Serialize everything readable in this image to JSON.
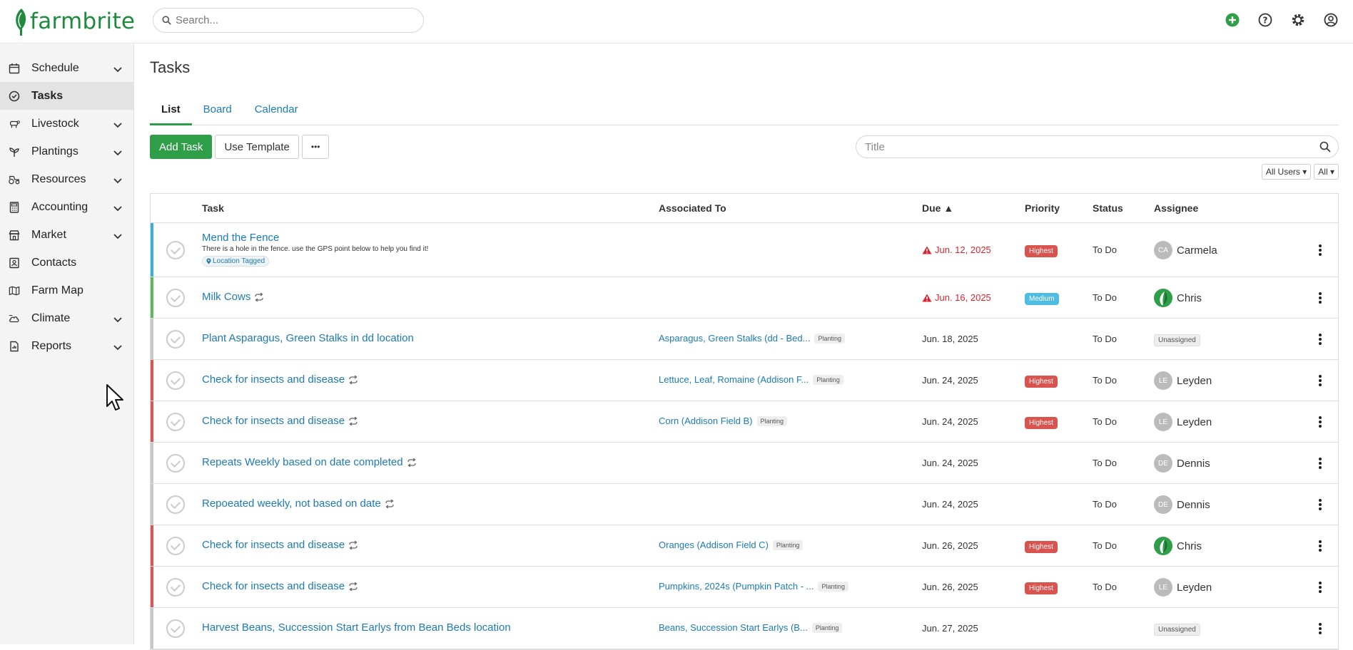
{
  "app": {
    "brand": "farmbrite"
  },
  "search": {
    "placeholder": "Search..."
  },
  "sidebar": {
    "items": [
      {
        "label": "Schedule",
        "icon": "calendar-icon",
        "expandable": true
      },
      {
        "label": "Tasks",
        "icon": "check-circle-icon",
        "expandable": false,
        "active": true
      },
      {
        "label": "Livestock",
        "icon": "livestock-icon",
        "expandable": true
      },
      {
        "label": "Plantings",
        "icon": "seedling-icon",
        "expandable": true
      },
      {
        "label": "Resources",
        "icon": "tractor-icon",
        "expandable": true
      },
      {
        "label": "Accounting",
        "icon": "calculator-icon",
        "expandable": true
      },
      {
        "label": "Market",
        "icon": "store-icon",
        "expandable": true
      },
      {
        "label": "Contacts",
        "icon": "contact-icon",
        "expandable": false
      },
      {
        "label": "Farm Map",
        "icon": "map-icon",
        "expandable": false
      },
      {
        "label": "Climate",
        "icon": "cloud-icon",
        "expandable": true
      },
      {
        "label": "Reports",
        "icon": "report-icon",
        "expandable": true
      }
    ]
  },
  "page": {
    "title": "Tasks"
  },
  "tabs": [
    {
      "label": "List",
      "active": true
    },
    {
      "label": "Board"
    },
    {
      "label": "Calendar"
    }
  ],
  "toolbar": {
    "add_task": "Add Task",
    "use_template": "Use Template",
    "more": "•••",
    "title_placeholder": "Title"
  },
  "filters": {
    "users": "All Users",
    "all": "All"
  },
  "table": {
    "headers": {
      "task": "Task",
      "associated": "Associated To",
      "due": "Due",
      "priority": "Priority",
      "status": "Status",
      "assignee": "Assignee"
    },
    "rows": [
      {
        "title": "Mend the Fence",
        "desc": "There is a hole in the fence. use the GPS point below to help you find it!",
        "tag": "Location Tagged",
        "color": "#3aaee0",
        "assoc": "",
        "assoc_tag": "",
        "due": "Jun. 12, 2025",
        "overdue": true,
        "priority": "Highest",
        "status": "To Do",
        "assignee": "Carmela",
        "initials": "CA",
        "repeat": false
      },
      {
        "title": "Milk Cows",
        "desc": "",
        "tag": "",
        "color": "#5cb85c",
        "assoc": "",
        "assoc_tag": "",
        "due": "Jun. 16, 2025",
        "overdue": true,
        "priority": "Medium",
        "status": "To Do",
        "assignee": "Chris",
        "initials": "",
        "repeat": true
      },
      {
        "title": "Plant Asparagus, Green Stalks in dd location",
        "desc": "",
        "tag": "",
        "color": "#c8c8c8",
        "assoc": "Asparagus, Green Stalks (dd - Bed...",
        "assoc_tag": "Planting",
        "due": "Jun. 18, 2025",
        "overdue": false,
        "priority": "",
        "status": "To Do",
        "assignee": "Unassigned",
        "initials": "",
        "repeat": false
      },
      {
        "title": "Check for insects and disease",
        "desc": "",
        "tag": "",
        "color": "#e05353",
        "assoc": "Lettuce, Leaf, Romaine (Addison F...",
        "assoc_tag": "Planting",
        "due": "Jun. 24, 2025",
        "overdue": false,
        "priority": "Highest",
        "status": "To Do",
        "assignee": "Leyden",
        "initials": "LE",
        "repeat": true
      },
      {
        "title": "Check for insects and disease",
        "desc": "",
        "tag": "",
        "color": "#e05353",
        "assoc": "Corn (Addison Field B)",
        "assoc_tag": "Planting",
        "due": "Jun. 24, 2025",
        "overdue": false,
        "priority": "Highest",
        "status": "To Do",
        "assignee": "Leyden",
        "initials": "LE",
        "repeat": true
      },
      {
        "title": "Repeats Weekly based on date completed",
        "desc": "",
        "tag": "",
        "color": "#c8c8c8",
        "assoc": "",
        "assoc_tag": "",
        "due": "Jun. 24, 2025",
        "overdue": false,
        "priority": "",
        "status": "To Do",
        "assignee": "Dennis",
        "initials": "DE",
        "repeat": true
      },
      {
        "title": "Repoeated weekly, not based on date",
        "desc": "",
        "tag": "",
        "color": "#c8c8c8",
        "assoc": "",
        "assoc_tag": "",
        "due": "Jun. 24, 2025",
        "overdue": false,
        "priority": "",
        "status": "To Do",
        "assignee": "Dennis",
        "initials": "DE",
        "repeat": true
      },
      {
        "title": "Check for insects and disease",
        "desc": "",
        "tag": "",
        "color": "#e05353",
        "assoc": "Oranges (Addison Field C)",
        "assoc_tag": "Planting",
        "due": "Jun. 26, 2025",
        "overdue": false,
        "priority": "Highest",
        "status": "To Do",
        "assignee": "Chris",
        "initials": "",
        "repeat": true
      },
      {
        "title": "Check for insects and disease",
        "desc": "",
        "tag": "",
        "color": "#e05353",
        "assoc": "Pumpkins, 2024s (Pumpkin Patch - ...",
        "assoc_tag": "Planting",
        "due": "Jun. 26, 2025",
        "overdue": false,
        "priority": "Highest",
        "status": "To Do",
        "assignee": "Leyden",
        "initials": "LE",
        "repeat": true
      },
      {
        "title": "Harvest Beans, Succession Start Earlys from Bean Beds location",
        "desc": "",
        "tag": "",
        "color": "#c8c8c8",
        "assoc": "Beans, Succession Start Earlys (B...",
        "assoc_tag": "Planting",
        "due": "Jun. 27, 2025",
        "overdue": false,
        "priority": "",
        "status": "",
        "assignee": "Unassigned",
        "initials": "",
        "repeat": false
      }
    ]
  }
}
